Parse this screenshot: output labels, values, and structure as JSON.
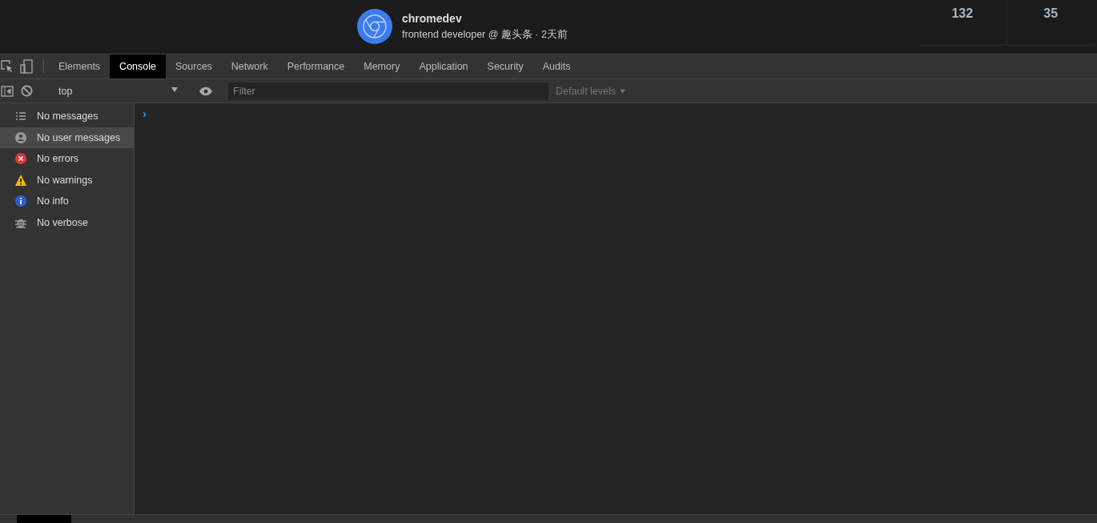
{
  "profile": {
    "name": "chromedev",
    "subtitle": "frontend developer @ 趣头条 · 2天前"
  },
  "stats": [
    {
      "value": "132"
    },
    {
      "value": "35"
    }
  ],
  "tabs": [
    {
      "label": "Elements",
      "selected": false
    },
    {
      "label": "Console",
      "selected": true
    },
    {
      "label": "Sources",
      "selected": false
    },
    {
      "label": "Network",
      "selected": false
    },
    {
      "label": "Performance",
      "selected": false
    },
    {
      "label": "Memory",
      "selected": false
    },
    {
      "label": "Application",
      "selected": false
    },
    {
      "label": "Security",
      "selected": false
    },
    {
      "label": "Audits",
      "selected": false
    }
  ],
  "toolbar": {
    "context": "top",
    "filter_placeholder": "Filter",
    "levels": "Default levels"
  },
  "sidebar": {
    "items": [
      {
        "kind": "list",
        "label": "No messages",
        "selected": false
      },
      {
        "kind": "user",
        "label": "No user messages",
        "selected": true
      },
      {
        "kind": "error",
        "label": "No errors",
        "selected": false
      },
      {
        "kind": "warning",
        "label": "No warnings",
        "selected": false
      },
      {
        "kind": "info",
        "label": "No info",
        "selected": false
      },
      {
        "kind": "verbose",
        "label": "No verbose",
        "selected": false
      }
    ]
  },
  "console": {
    "prompt": "›"
  }
}
